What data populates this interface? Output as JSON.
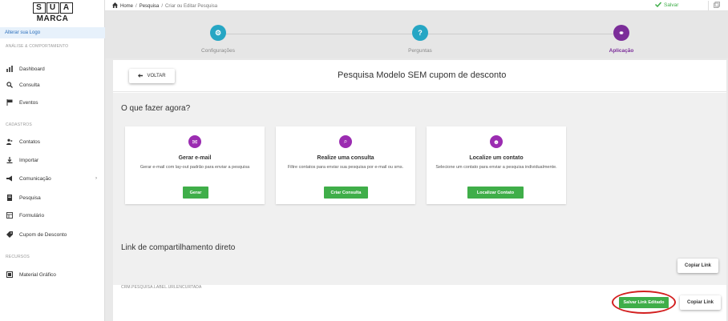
{
  "brand": {
    "letters": [
      "S",
      "U",
      "A"
    ],
    "sub": "MARCA",
    "change_logo": "Alterar sua Logo"
  },
  "sidebar": {
    "section_analysis": "ANÁLISE & COMPORTAMENTO",
    "section_cadastros": "CADASTROS",
    "section_recursos": "RECURSOS",
    "items": [
      {
        "label": "Dashboard",
        "icon": "bar-chart-icon"
      },
      {
        "label": "Consulta",
        "icon": "search-icon"
      },
      {
        "label": "Eventos",
        "icon": "flag-icon"
      },
      {
        "label": "Contatos",
        "icon": "contacts-icon"
      },
      {
        "label": "Importar",
        "icon": "download-icon"
      },
      {
        "label": "Comunicação",
        "icon": "megaphone-icon"
      },
      {
        "label": "Pesquisa",
        "icon": "survey-icon"
      },
      {
        "label": "Formulário",
        "icon": "form-icon"
      },
      {
        "label": "Cupom de Desconto",
        "icon": "tag-icon"
      },
      {
        "label": "Material Gráfico",
        "icon": "image-icon"
      }
    ]
  },
  "topbar": {
    "home": "Home",
    "sep1": "/",
    "crumb1": "Pesquisa",
    "sep2": "/",
    "crumb2": "Criar ou Editar Pesquisa",
    "save": "Salvar"
  },
  "stepper": {
    "steps": [
      {
        "label": "Configurações",
        "icon": "gear-icon",
        "glyph": "⚙",
        "color": "#26a6c4"
      },
      {
        "label": "Perguntas",
        "icon": "question-icon",
        "glyph": "?",
        "color": "#26a6c4"
      },
      {
        "label": "Aplicação",
        "icon": "link-icon",
        "glyph": "⚭",
        "color": "#7b2d99"
      }
    ]
  },
  "main": {
    "back_label": "VOLTAR",
    "title": "Pesquisa Modelo SEM cupom de desconto",
    "question": "O que fazer agora?",
    "cards": [
      {
        "title": "Gerar e-mail",
        "desc": "Gerar e-mail com lay-out padrão para enviar a pesquisa",
        "button": "Gerar",
        "icon": "mail-icon",
        "glyph": "✉"
      },
      {
        "title": "Realize uma consulta",
        "desc": "Filtre contatos para enviar sua pesquisa por e-mail ou sms.",
        "button": "Criar Consulta",
        "icon": "search-icon",
        "glyph": "⌕"
      },
      {
        "title": "Localize um contato",
        "desc": "Selecione um contato para enviar a pesquisa individualmente.",
        "button": "Localizar Contato",
        "icon": "contact-icon",
        "glyph": "☻"
      }
    ],
    "link_title": "Link de compartilhamento direto",
    "copy_link": "Copiar Link",
    "url_label": "CRM.PESQUISA.LABEL.URLENCURTADA",
    "save_link": "Salvar Link Editado",
    "copy_link_2": "Copiar Link"
  },
  "colors": {
    "accent_green": "#3fae49",
    "accent_purple": "#9b2cb1",
    "step_teal": "#26a6c4",
    "highlight_red": "#d32020"
  }
}
